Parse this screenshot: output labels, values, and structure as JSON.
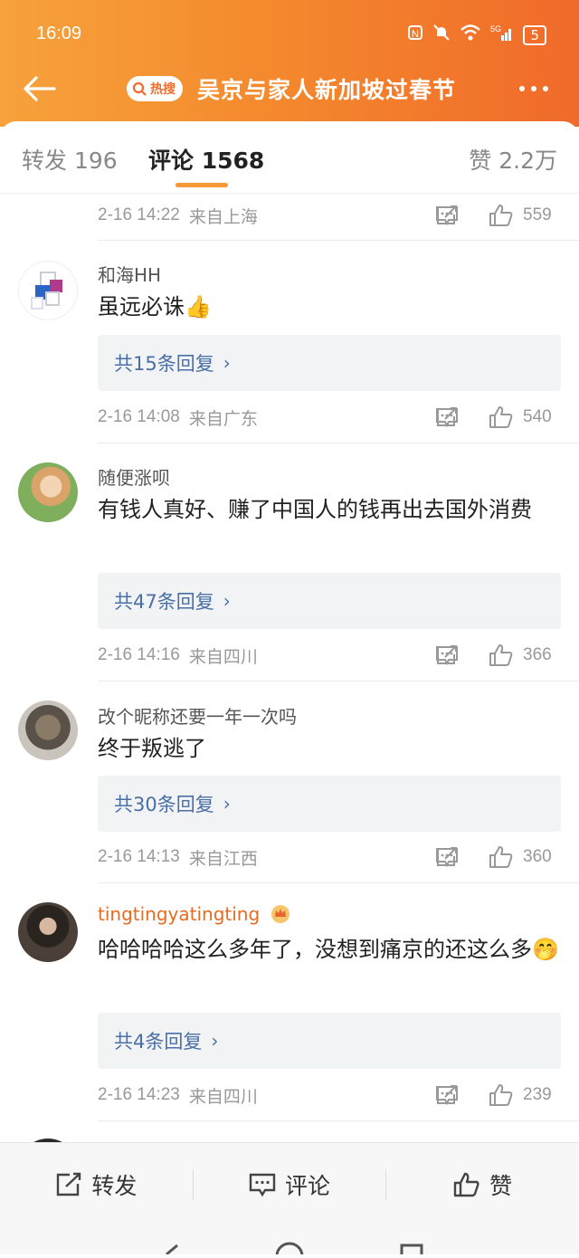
{
  "status": {
    "time": "16:09",
    "battery": "5",
    "network": "5G"
  },
  "nav": {
    "badge": "热搜",
    "title": "吴京与家人新加坡过春节"
  },
  "tabs": [
    {
      "label": "转发 196"
    },
    {
      "label": "评论 1568"
    },
    {
      "label": "赞 2.2万"
    }
  ],
  "top_meta": {
    "date": "2-16 14:22",
    "from": "来自上海",
    "likes": "559"
  },
  "comments": [
    {
      "user": "和海HH",
      "text": "虽远必诛👍",
      "replies": "共15条回复",
      "date": "2-16 14:08",
      "from": "来自广东",
      "likes": "540"
    },
    {
      "user": "随便涨呗",
      "text": "有钱人真好、赚了中国人的钱再出去国外消费",
      "replies": "共47条回复",
      "date": "2-16 14:16",
      "from": "来自四川",
      "likes": "366"
    },
    {
      "user": "改个昵称还要一年一次吗",
      "text": "终于叛逃了",
      "replies": "共30条回复",
      "date": "2-16 14:13",
      "from": "来自江西",
      "likes": "360"
    },
    {
      "user": "tingtingyatingting",
      "text": "哈哈哈哈这么多年了，没想到痛京的还这么多🤭",
      "replies": "共4条回复",
      "date": "2-16 14:23",
      "from": "来自四川",
      "likes": "239"
    }
  ],
  "bottom": {
    "repost": "转发",
    "comment": "评论",
    "like": "赞"
  },
  "colors": {
    "header_start": "#f7a23c",
    "header_end": "#f06a2a",
    "accent": "#f59a37",
    "link": "#4a6fa5",
    "vip_name": "#e86b1f"
  }
}
